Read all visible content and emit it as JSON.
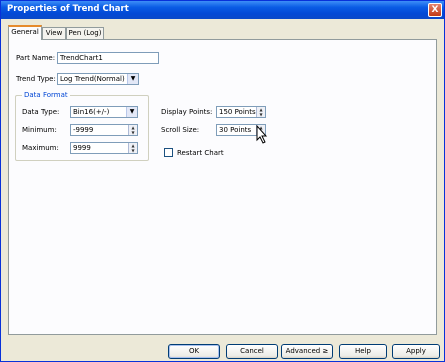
{
  "window": {
    "title": "Properties of Trend Chart",
    "close_glyph": "X"
  },
  "tabs": [
    {
      "label": "General",
      "active": true
    },
    {
      "label": "View",
      "active": false
    },
    {
      "label": "Pen (Log)",
      "active": false
    }
  ],
  "general": {
    "part_name_label": "Part Name:",
    "part_name_value": "TrendChart1",
    "trend_type_label": "Trend Type:",
    "trend_type_value": "Log Trend(Normal)",
    "data_format": {
      "title": "Data Format",
      "data_type_label": "Data Type:",
      "data_type_value": "Bin16(+/-)",
      "minimum_label": "Minimum:",
      "minimum_value": "-9999",
      "maximum_label": "Maximum:",
      "maximum_value": "9999"
    },
    "display_points_label": "Display Points:",
    "display_points_value": "150 Points",
    "scroll_size_label": "Scroll Size:",
    "scroll_size_value": "30 Points",
    "restart_chart_label": "Restart Chart",
    "restart_chart_checked": false
  },
  "buttons": {
    "ok": "OK",
    "cancel": "Cancel",
    "advanced": "Advanced ≥",
    "help": "Help",
    "apply": "Apply"
  },
  "colors": {
    "title_bar": "#0a5be4",
    "group_title": "#0046d5",
    "active_tab_accent": "#e68b2c"
  }
}
